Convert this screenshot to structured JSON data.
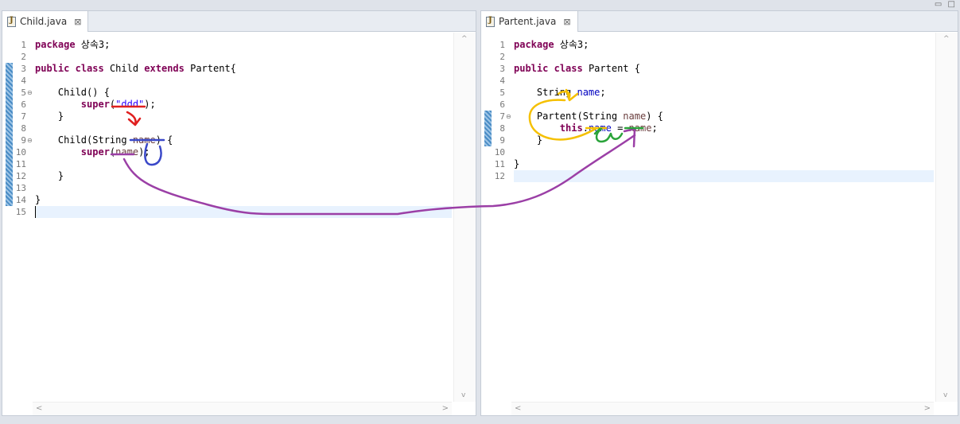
{
  "window_controls": "▭ □",
  "left_editor": {
    "tab": {
      "title": "Child.java",
      "close": "⊠",
      "icon": "java-file-icon"
    },
    "lines": [
      [
        {
          "t": "package",
          "c": "kw"
        },
        {
          "t": " 상속3;"
        }
      ],
      [],
      [
        {
          "t": "public",
          "c": "kw"
        },
        {
          "t": " "
        },
        {
          "t": "class",
          "c": "kw"
        },
        {
          "t": " Child "
        },
        {
          "t": "extends",
          "c": "kw"
        },
        {
          "t": " Partent{"
        }
      ],
      [],
      [
        {
          "t": "    Child() {"
        }
      ],
      [
        {
          "t": "        "
        },
        {
          "t": "super",
          "c": "kw"
        },
        {
          "t": "("
        },
        {
          "t": "\"ddd\"",
          "c": "str"
        },
        {
          "t": ");"
        }
      ],
      [
        {
          "t": "    }"
        }
      ],
      [],
      [
        {
          "t": "    Child(String "
        },
        {
          "t": "name",
          "c": "prm"
        },
        {
          "t": ") {"
        }
      ],
      [
        {
          "t": "        "
        },
        {
          "t": "super",
          "c": "kw"
        },
        {
          "t": "("
        },
        {
          "t": "name",
          "c": "prm"
        },
        {
          "t": ");"
        }
      ],
      [],
      [
        {
          "t": "    }"
        }
      ],
      [],
      [
        {
          "t": "}"
        }
      ],
      []
    ],
    "line_numbers": [
      "1",
      "2",
      "3",
      "4",
      "5",
      "6",
      "7",
      "8",
      "9",
      "10",
      "11",
      "12",
      "13",
      "14",
      "15"
    ],
    "fold_markers": {
      "5": "⊖",
      "9": "⊖"
    },
    "current_line": 15
  },
  "right_editor": {
    "tab": {
      "title": "Partent.java",
      "close": "⊠",
      "icon": "java-file-icon"
    },
    "lines": [
      [
        {
          "t": "package",
          "c": "kw"
        },
        {
          "t": " 상속3;"
        }
      ],
      [],
      [
        {
          "t": "public",
          "c": "kw"
        },
        {
          "t": " "
        },
        {
          "t": "class",
          "c": "kw"
        },
        {
          "t": " Partent {"
        }
      ],
      [],
      [
        {
          "t": "    String "
        },
        {
          "t": "name",
          "c": "fld"
        },
        {
          "t": ";"
        }
      ],
      [],
      [
        {
          "t": "    Partent(String "
        },
        {
          "t": "name",
          "c": "prm"
        },
        {
          "t": ") {"
        }
      ],
      [
        {
          "t": "        "
        },
        {
          "t": "this",
          "c": "kw"
        },
        {
          "t": "."
        },
        {
          "t": "name",
          "c": "fld"
        },
        {
          "t": " = "
        },
        {
          "t": "name",
          "c": "prm"
        },
        {
          "t": ";"
        }
      ],
      [
        {
          "t": "    }"
        }
      ],
      [],
      [
        {
          "t": "}"
        }
      ],
      []
    ],
    "line_numbers": [
      "1",
      "2",
      "3",
      "4",
      "5",
      "6",
      "7",
      "8",
      "9",
      "10",
      "11",
      "12"
    ],
    "fold_markers": {
      "7": "⊖"
    },
    "current_line": 12
  },
  "scroll_arrows": {
    "up": "^",
    "down": "v",
    "left": "<",
    "right": ">"
  },
  "annotation_colors": {
    "red": "#e02020",
    "blue": "#3a48c8",
    "purple": "#9b3fa6",
    "yellow": "#f5c000",
    "green": "#2aa33a"
  }
}
